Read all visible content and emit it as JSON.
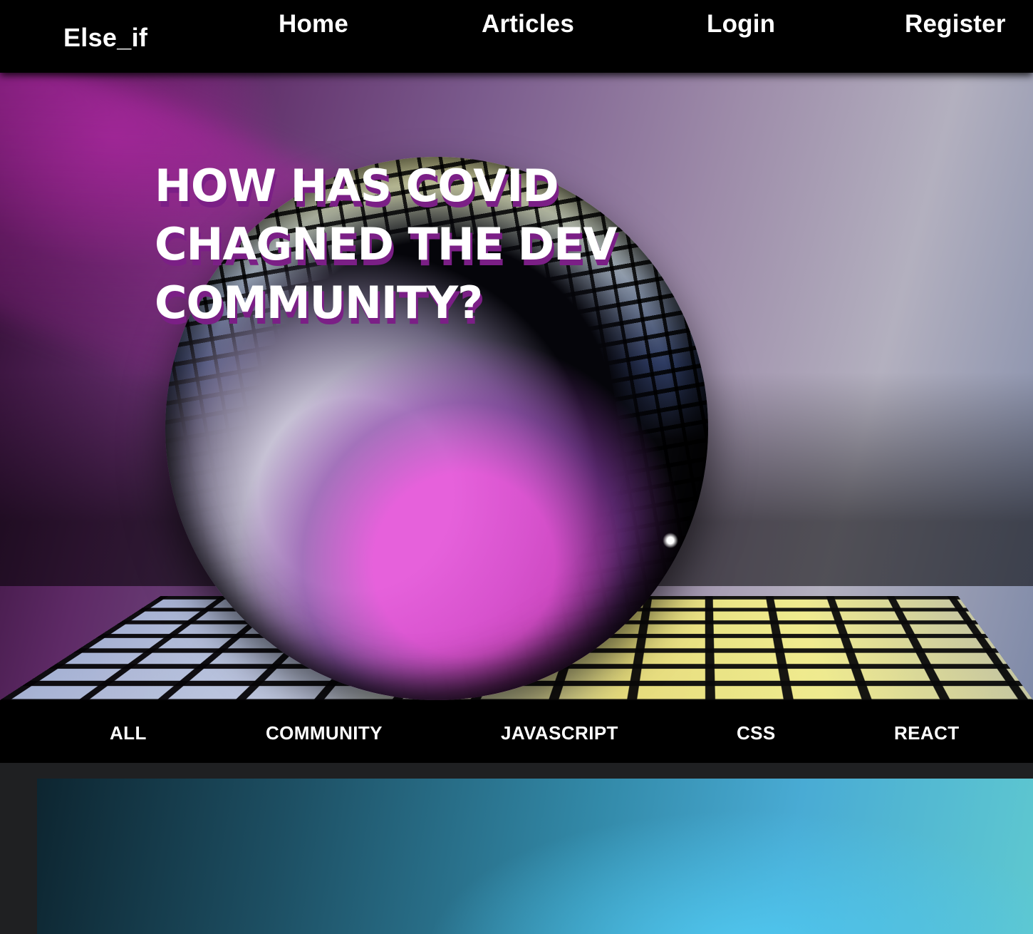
{
  "nav": {
    "brand": "Else_if",
    "links": {
      "home": "Home",
      "articles": "Articles",
      "login": "Login",
      "register": "Register"
    }
  },
  "hero": {
    "title": "HOW HAS COVID CHAGNED THE DEV COMMUNITY?",
    "title_color": "#ffffff",
    "title_shadow_color": "#7b1f86"
  },
  "categories": {
    "all": "ALL",
    "community": "COMMUNITY",
    "javascript": "JAVASCRIPT",
    "css": "CSS",
    "react": "REACT"
  },
  "colors": {
    "nav_background": "#000000",
    "page_background": "#1f2022",
    "accent_purple": "#7b1f86"
  }
}
